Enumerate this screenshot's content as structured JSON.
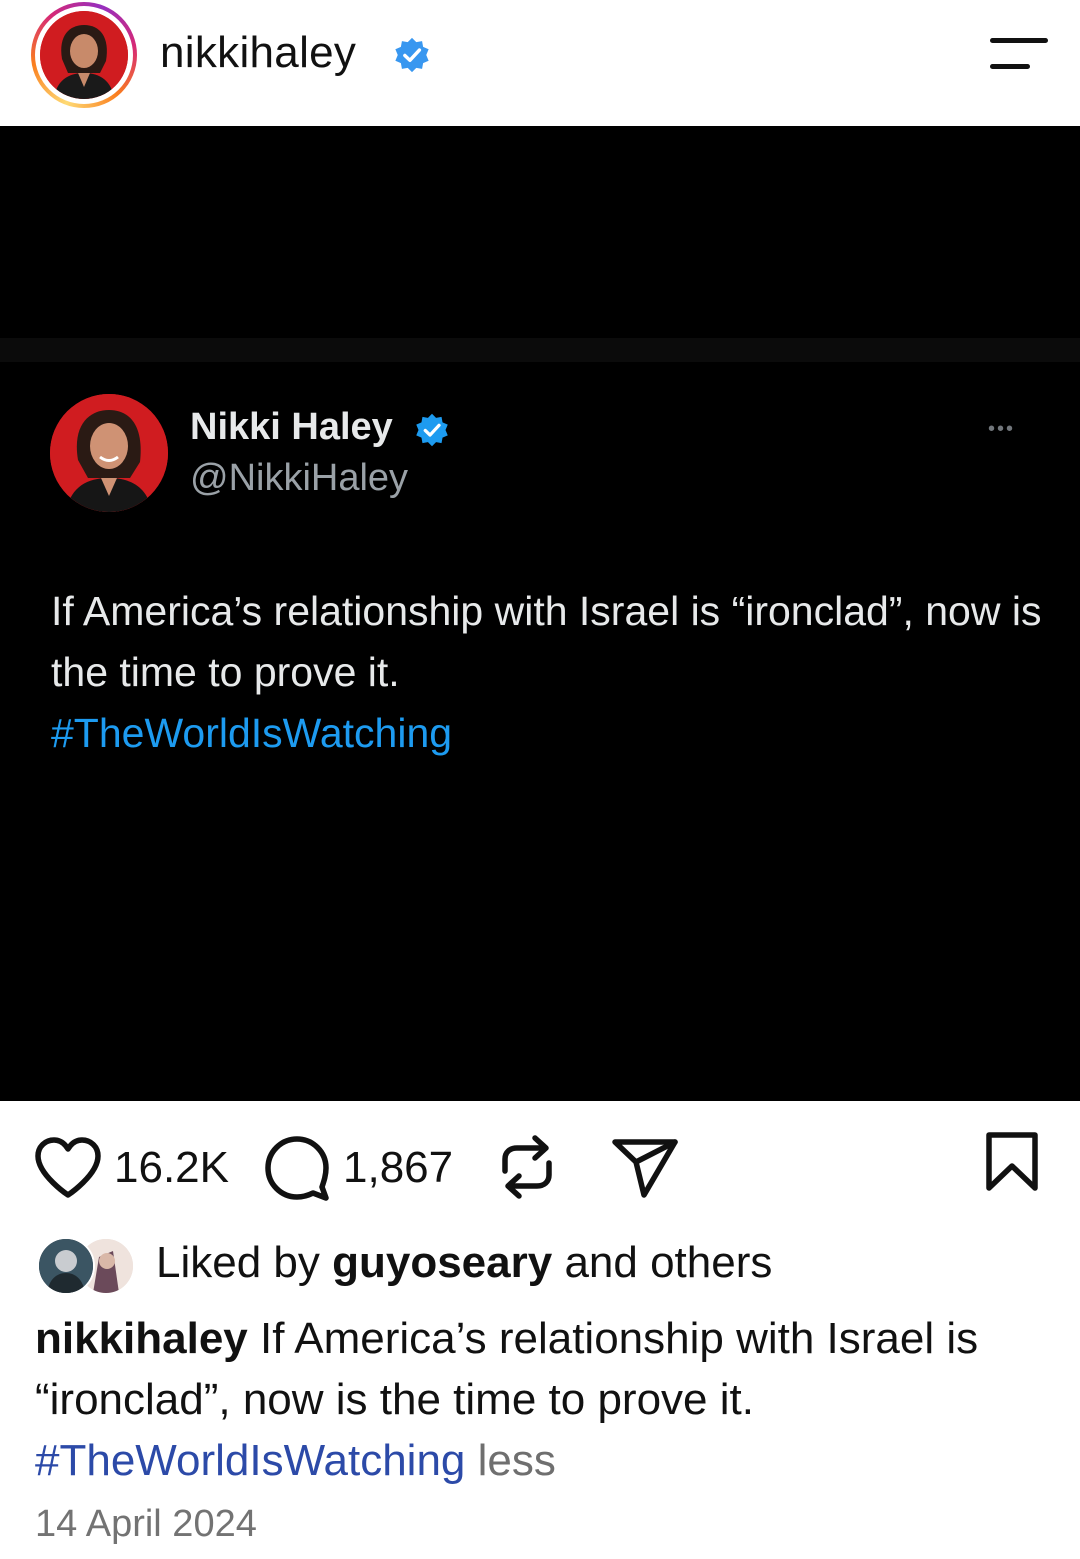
{
  "header": {
    "username": "nikkihaley",
    "verified_icon": "verified-badge-icon",
    "menu_icon": "menu-icon"
  },
  "post": {
    "tweet": {
      "name": "Nikki Haley",
      "handle": "@NikkiHaley",
      "more": "•••",
      "text": "If America’s relationship with Israel is “ironclad”, now is the time to prove it.",
      "hashtag": "#TheWorldIsWatching"
    }
  },
  "actions": {
    "likes": "16.2K",
    "comments": "1,867",
    "icons": [
      "heart-icon",
      "comment-icon",
      "repost-icon",
      "share-icon",
      "bookmark-icon"
    ]
  },
  "liked_by": {
    "prefix": "Liked by ",
    "user": "guyoseary",
    "suffix": " and others"
  },
  "caption": {
    "username": "nikkihaley",
    "text": " If America’s relationship with Israel is “ironclad”, now is the time to prove it. ",
    "hashtag": "#TheWorldIsWatching",
    "less": " less"
  },
  "date": "14 April 2024",
  "colors": {
    "link_blue": "#1d9bf0",
    "caption_hashtag": "#2c4aa8",
    "verified": "#3897f0"
  }
}
